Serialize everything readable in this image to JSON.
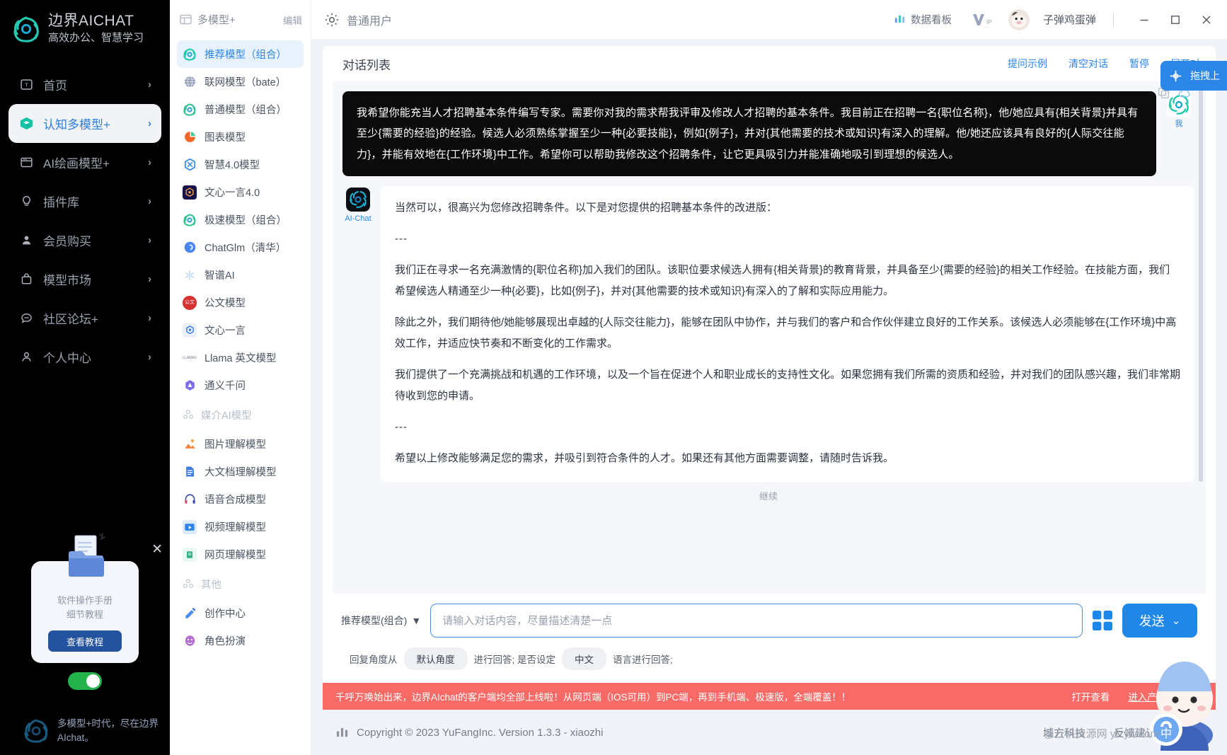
{
  "brand": {
    "title": "边界AICHAT",
    "subtitle": "高效办公、智慧学习",
    "logo_icon": "lotus-logo-icon"
  },
  "sidebar": {
    "items": [
      {
        "label": "首页",
        "icon": "home-icon",
        "arrow": "›",
        "active": false
      },
      {
        "label": "认知多模型+",
        "icon": "cube-icon",
        "arrow": "›",
        "active": true
      },
      {
        "label": "AI绘画模型+",
        "icon": "palette-icon",
        "arrow": "›",
        "active": false
      },
      {
        "label": "插件库",
        "icon": "bulb-icon",
        "arrow": "›",
        "active": false
      },
      {
        "label": "会员购买",
        "icon": "person-icon",
        "arrow": "›",
        "active": false
      },
      {
        "label": "模型市场",
        "icon": "bag-icon",
        "arrow": "›",
        "active": false
      },
      {
        "label": "社区论坛+",
        "icon": "chat-icon",
        "arrow": "›",
        "active": false
      },
      {
        "label": "个人中心",
        "icon": "user-icon",
        "arrow": "›",
        "active": false
      }
    ],
    "promo": {
      "line1": "软件操作手册",
      "line2": "细节教程",
      "button": "查看教程",
      "close_icon": "close-icon",
      "folder_icon": "folder-document-icon"
    },
    "toggle_on": true,
    "footer_text": "多模型+时代，尽在边界AIchat。"
  },
  "model_panel": {
    "header_title": "多模型+",
    "header_icon": "layout-icon",
    "edit_label": "编辑",
    "items": [
      {
        "label": "推荐模型（组合）",
        "icon": "lotus-teal-icon",
        "active": true
      },
      {
        "label": "联网模型（bate）",
        "icon": "globe-icon",
        "active": false
      },
      {
        "label": "普通模型（组合）",
        "icon": "lotus-green-icon",
        "active": false
      },
      {
        "label": "图表模型",
        "icon": "pie-chart-icon",
        "active": false
      },
      {
        "label": "智慧4.0模型",
        "icon": "hexagon-blue-icon",
        "active": false
      },
      {
        "label": "文心一言4.0",
        "icon": "wenxin-dark-icon",
        "active": false
      },
      {
        "label": "极速模型（组合）",
        "icon": "lotus-green-icon",
        "active": false
      },
      {
        "label": "ChatGlm（清华）",
        "icon": "chatglm-icon",
        "active": false
      },
      {
        "label": "智谱AI",
        "icon": "snowflake-icon",
        "active": false
      },
      {
        "label": "公文模型",
        "icon": "red-circle-icon",
        "active": false
      },
      {
        "label": "文心一言",
        "icon": "wenxin-blue-icon",
        "active": false
      },
      {
        "label": "Llama 英文模型",
        "icon": "llama-icon",
        "active": false
      },
      {
        "label": "通义千问",
        "icon": "tongyi-icon",
        "active": false
      }
    ],
    "group_media": {
      "label": "媒介AI模型",
      "icon": "cluster-icon"
    },
    "media_items": [
      {
        "label": "图片理解模型",
        "icon": "image-icon"
      },
      {
        "label": "大文档理解模型",
        "icon": "document-icon"
      },
      {
        "label": "语音合成模型",
        "icon": "headphone-icon"
      },
      {
        "label": "视频理解模型",
        "icon": "video-icon"
      },
      {
        "label": "网页理解模型",
        "icon": "webpage-icon"
      }
    ],
    "group_other": {
      "label": "其他",
      "icon": "cluster-icon"
    },
    "other_items": [
      {
        "label": "创作中心",
        "icon": "pencil-icon"
      },
      {
        "label": "角色扮演",
        "icon": "mask-icon"
      }
    ]
  },
  "topbar": {
    "gear_icon": "gear-icon",
    "user_type": "普通用户",
    "dashboard_label": "数据看板",
    "dashboard_icon": "bar-chart-icon",
    "vip_icon": "vip-icon",
    "avatar_icon": "avatar",
    "username": "子弹鸡蛋弹",
    "minimize_icon": "minimize-icon",
    "maximize_icon": "maximize-icon",
    "close_icon": "close-icon"
  },
  "conversation": {
    "title": "对话列表",
    "links": [
      "提问示例",
      "清空对话",
      "暂停",
      "展开对"
    ],
    "user_message": "我希望你能充当人才招聘基本条件编写专家。需要你对我的需求帮我评审及修改人才招聘的基本条件。我目前正在招聘一名{职位名称}，他/她应具有{相关背景}并具有至少{需要的经验}的经验。候选人必须熟练掌握至少一种{必要技能}，例如{例子}，并对{其他需要的技术或知识}有深入的理解。他/她还应该具有良好的{人际交往能力}，并能有效地在{工作环境}中工作。希望你可以帮助我修改这个招聘条件，让它更具吸引力并能准确地吸引到理想的候选人。",
    "user_avatar_label": "我",
    "ai_avatar_label": "AI-Chat",
    "ai_paragraphs": [
      "当然可以，很高兴为您修改招聘条件。以下是对您提供的招聘基本条件的改进版：",
      "---",
      "我们正在寻求一名充满激情的{职位名称}加入我们的团队。该职位要求候选人拥有{相关背景}的教育背景，并具备至少{需要的经验}的相关工作经验。在技能方面，我们希望候选人精通至少一种{必要}，比如{例子}，并对{其他需要的技术或知识}有深入的了解和实际应用能力。",
      "除此之外，我们期待他/她能够展现出卓越的{人际交往能力}，能够在团队中协作，并与我们的客户和合作伙伴建立良好的工作关系。该候选人必须能够在{工作环境}中高效工作，并适应快节奏和不断变化的工作需求。",
      "我们提供了一个充满挑战和机遇的工作环境，以及一个旨在促进个人和职业成长的支持性文化。如果您拥有我们所需的资质和经验，并对我们的团队感兴趣，我们非常期待收到您的申请。",
      "---",
      "希望以上修改能够满足您的需求，并吸引到符合条件的人才。如果还有其他方面需要调整，请随时告诉我。"
    ],
    "continue_label": "继续",
    "copy_icon": "copy-icon",
    "cloud_icon": "cloud-icon"
  },
  "composer": {
    "model_selector": "推荐模型(组合)",
    "model_selector_arrow": "▼",
    "input_value": "",
    "input_placeholder": "请输入对话内容，尽量描述清楚一点",
    "qr_icon": "qr-code-icon",
    "send_label": "发送",
    "send_arrow": "⌄",
    "options": {
      "prefix": "回复角度从",
      "angle_chip": "默认角度",
      "middle": "进行回答; 是否设定",
      "lang_chip": "中文",
      "suffix": "语言进行回答;"
    }
  },
  "banner": {
    "text": "千呼万唤始出来，边界AIchat的客户端均全部上线啦！从网页端（IOS可用）到PC端，再到手机端、极速版，全端覆盖！！",
    "link1": "打开查看",
    "link2": "进入产品页",
    "close_icon": "close-icon"
  },
  "footer": {
    "icon": "bar-chart-icon",
    "copyright": "Copyright © 2023 YuFangInc. Version 1.3.3 - xiaozhi",
    "links": [
      "域方科技",
      "反馈建议",
      "加入"
    ]
  },
  "floating": {
    "drag_label": "拖拽上",
    "drag_icon": "drag-icon",
    "watermark": "@云帆资源网 yfzyw.com",
    "mascot_icon": "mascot-icon"
  },
  "colors": {
    "accent": "#2b86e8",
    "sidebar_bg": "#000000",
    "banner_bg": "#f76a66",
    "toggle_on": "#24b24c",
    "dark_bubble": "#0b0b0b"
  }
}
